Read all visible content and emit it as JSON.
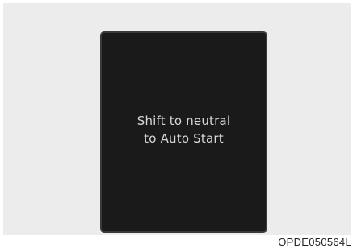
{
  "display": {
    "message_line1": "Shift to neutral",
    "message_line2": "to Auto Start"
  },
  "figure": {
    "code": "OPDE050564L"
  },
  "colors": {
    "panel_background": "#ececec",
    "screen_background": "#1a1a1a",
    "message_text": "#d8d8d8"
  }
}
